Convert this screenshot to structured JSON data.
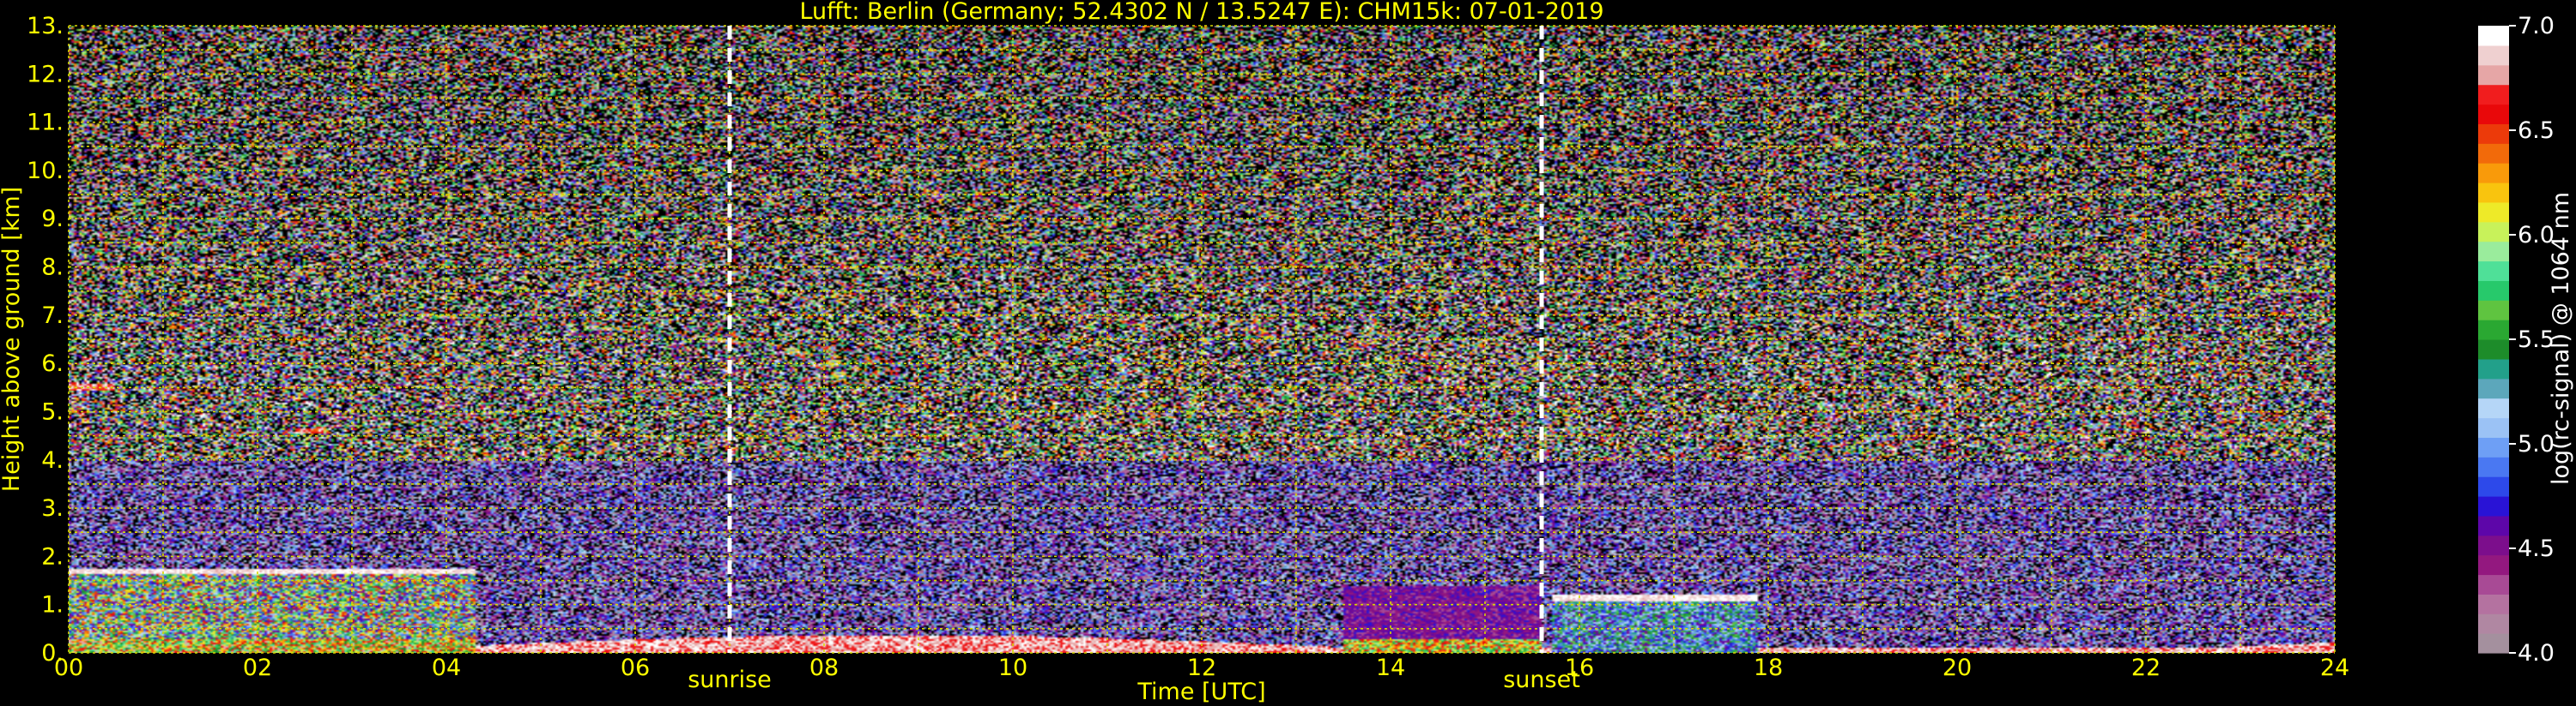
{
  "chart_data": {
    "type": "heatmap",
    "title": "Lufft: Berlin (Germany; 52.4302 N / 13.5247 E):    CHM15k: 07-01-2019",
    "xlabel": "Time [UTC]",
    "ylabel": "Height above ground [km]",
    "xlim": [
      0,
      24
    ],
    "ylim": [
      0,
      13
    ],
    "x_ticks": [
      "00",
      "02",
      "04",
      "06",
      "08",
      "10",
      "12",
      "14",
      "16",
      "18",
      "20",
      "22",
      "24"
    ],
    "y_ticks": [
      "0.",
      "1.",
      "2.",
      "3.",
      "4.",
      "5.",
      "6.",
      "7.",
      "8.",
      "9.",
      "10.",
      "11.",
      "12.",
      "13."
    ],
    "x_gridlines": [
      0,
      1,
      2,
      3,
      4,
      5,
      6,
      7,
      8,
      9,
      10,
      11,
      12,
      13,
      14,
      15,
      16,
      17,
      18,
      19,
      20,
      21,
      22,
      23,
      24
    ],
    "y_gridlines": [
      0,
      0.5,
      1,
      1.5,
      2,
      2.5,
      3,
      3.5,
      4,
      4.5,
      5,
      5.5,
      6,
      6.5,
      7,
      7.5,
      8,
      8.5,
      9,
      9.5,
      10,
      10.5,
      11,
      11.5,
      12,
      12.5,
      13
    ],
    "grid": true,
    "annotations": [
      {
        "label": "sunrise",
        "time": 7.0
      },
      {
        "label": "sunset",
        "time": 15.6
      }
    ],
    "colorbar": {
      "label": "log(rc-signal) @ 1064 nm",
      "range": [
        4.0,
        7.0
      ],
      "ticks": [
        "4.0",
        "4.5",
        "5.0",
        "5.5",
        "6.0",
        "6.5",
        "7.0"
      ],
      "levels": [
        "#a4909e",
        "#b087a2",
        "#b472a0",
        "#a84a95",
        "#93187f",
        "#7c0e8c",
        "#5d06a9",
        "#2913d6",
        "#2d49ea",
        "#4a78f2",
        "#6e9ff5",
        "#9bc2f5",
        "#b5d6f7",
        "#5ca7bb",
        "#22a08a",
        "#1d8c2a",
        "#2aa832",
        "#5fc440",
        "#27c96b",
        "#4fe098",
        "#9aec9c",
        "#c8f25a",
        "#eeea28",
        "#f9c40e",
        "#f99a0a",
        "#f26a0a",
        "#ec3a0a",
        "#e9080a",
        "#f11d1e",
        "#e6a6a6",
        "#efd0d0",
        "#ffffff"
      ],
      "level_thresholds": [
        4.0,
        4.1,
        4.2,
        4.3,
        4.4,
        4.5,
        4.6,
        4.7,
        4.8,
        4.9,
        5.0,
        5.1,
        5.2,
        5.3,
        5.4,
        5.5,
        5.6,
        5.7,
        5.8,
        5.9,
        6.0,
        6.1,
        6.2,
        6.3,
        6.4,
        6.5,
        6.6,
        6.7,
        6.8,
        6.9,
        7.0
      ]
    },
    "features": [
      {
        "name": "night boundary layer",
        "time_range": [
          0,
          4.3
        ],
        "height_top_km": 1.75
      },
      {
        "name": "elevated layer",
        "time_range": [
          0.0,
          0.5
        ],
        "height_km": 5.5
      },
      {
        "name": "elevated layer",
        "time_range": [
          2.4,
          2.7
        ],
        "height_km": 4.6
      },
      {
        "name": "afternoon boundary layer",
        "time_range": [
          15.7,
          17.9
        ],
        "height_top_km": 1.2
      },
      {
        "name": "afternoon aerosol",
        "time_range": [
          13.5,
          15.6
        ],
        "height_top_km": 1.4
      },
      {
        "name": "surface layer",
        "time_range": [
          4.3,
          24
        ],
        "height_top_km": 0.35
      }
    ]
  }
}
